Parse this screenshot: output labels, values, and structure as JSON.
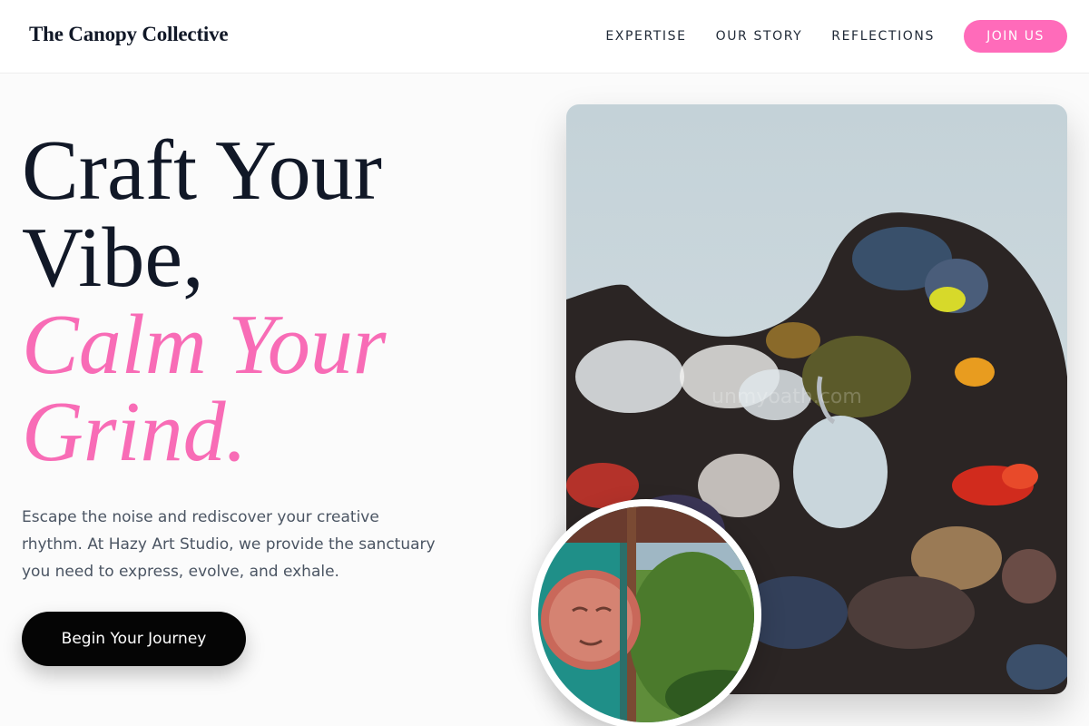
{
  "header": {
    "brand": "The Canopy Collective",
    "nav": [
      "EXPERTISE",
      "OUR STORY",
      "REFLECTIONS"
    ],
    "join_label": "JOIN US"
  },
  "hero": {
    "title_lines": [
      "Craft Your",
      "Vibe,"
    ],
    "accent_lines": [
      "Calm Your",
      "Grind."
    ],
    "subtitle": "Escape the noise and rediscover your creative rhythm. At Hazy Art Studio, we provide the sanctuary you need to express, evolve, and exhale.",
    "cta_label": "Begin Your Journey"
  },
  "images": {
    "main_watermark": "unmyoath.com",
    "main_subject": "paint-palette-photo",
    "round_subject": "painted-mask-doorway-photo"
  },
  "colors": {
    "accent_pink": "#f86cb6",
    "button_pink": "#ff6bba",
    "cta_black": "#050505",
    "text_dark": "#111827",
    "text_muted": "#4b5563"
  }
}
